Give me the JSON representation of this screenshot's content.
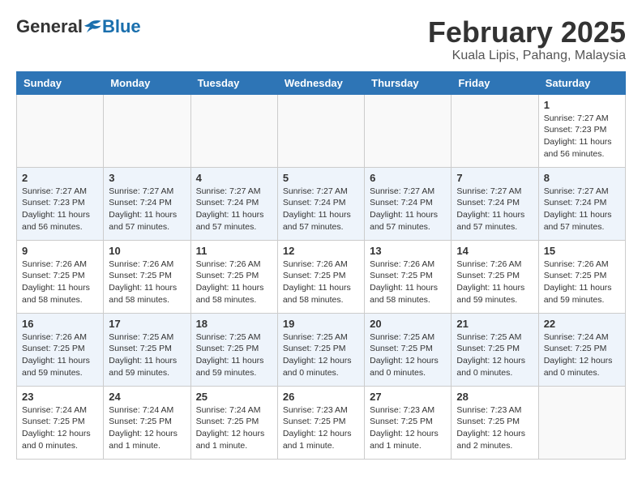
{
  "header": {
    "logo_general": "General",
    "logo_blue": "Blue",
    "title": "February 2025",
    "subtitle": "Kuala Lipis, Pahang, Malaysia"
  },
  "weekdays": [
    "Sunday",
    "Monday",
    "Tuesday",
    "Wednesday",
    "Thursday",
    "Friday",
    "Saturday"
  ],
  "weeks": [
    [
      {
        "day": "",
        "info": ""
      },
      {
        "day": "",
        "info": ""
      },
      {
        "day": "",
        "info": ""
      },
      {
        "day": "",
        "info": ""
      },
      {
        "day": "",
        "info": ""
      },
      {
        "day": "",
        "info": ""
      },
      {
        "day": "1",
        "info": "Sunrise: 7:27 AM\nSunset: 7:23 PM\nDaylight: 11 hours\nand 56 minutes."
      }
    ],
    [
      {
        "day": "2",
        "info": "Sunrise: 7:27 AM\nSunset: 7:23 PM\nDaylight: 11 hours\nand 56 minutes."
      },
      {
        "day": "3",
        "info": "Sunrise: 7:27 AM\nSunset: 7:24 PM\nDaylight: 11 hours\nand 57 minutes."
      },
      {
        "day": "4",
        "info": "Sunrise: 7:27 AM\nSunset: 7:24 PM\nDaylight: 11 hours\nand 57 minutes."
      },
      {
        "day": "5",
        "info": "Sunrise: 7:27 AM\nSunset: 7:24 PM\nDaylight: 11 hours\nand 57 minutes."
      },
      {
        "day": "6",
        "info": "Sunrise: 7:27 AM\nSunset: 7:24 PM\nDaylight: 11 hours\nand 57 minutes."
      },
      {
        "day": "7",
        "info": "Sunrise: 7:27 AM\nSunset: 7:24 PM\nDaylight: 11 hours\nand 57 minutes."
      },
      {
        "day": "8",
        "info": "Sunrise: 7:27 AM\nSunset: 7:24 PM\nDaylight: 11 hours\nand 57 minutes."
      }
    ],
    [
      {
        "day": "9",
        "info": "Sunrise: 7:26 AM\nSunset: 7:25 PM\nDaylight: 11 hours\nand 58 minutes."
      },
      {
        "day": "10",
        "info": "Sunrise: 7:26 AM\nSunset: 7:25 PM\nDaylight: 11 hours\nand 58 minutes."
      },
      {
        "day": "11",
        "info": "Sunrise: 7:26 AM\nSunset: 7:25 PM\nDaylight: 11 hours\nand 58 minutes."
      },
      {
        "day": "12",
        "info": "Sunrise: 7:26 AM\nSunset: 7:25 PM\nDaylight: 11 hours\nand 58 minutes."
      },
      {
        "day": "13",
        "info": "Sunrise: 7:26 AM\nSunset: 7:25 PM\nDaylight: 11 hours\nand 58 minutes."
      },
      {
        "day": "14",
        "info": "Sunrise: 7:26 AM\nSunset: 7:25 PM\nDaylight: 11 hours\nand 59 minutes."
      },
      {
        "day": "15",
        "info": "Sunrise: 7:26 AM\nSunset: 7:25 PM\nDaylight: 11 hours\nand 59 minutes."
      }
    ],
    [
      {
        "day": "16",
        "info": "Sunrise: 7:26 AM\nSunset: 7:25 PM\nDaylight: 11 hours\nand 59 minutes."
      },
      {
        "day": "17",
        "info": "Sunrise: 7:25 AM\nSunset: 7:25 PM\nDaylight: 11 hours\nand 59 minutes."
      },
      {
        "day": "18",
        "info": "Sunrise: 7:25 AM\nSunset: 7:25 PM\nDaylight: 11 hours\nand 59 minutes."
      },
      {
        "day": "19",
        "info": "Sunrise: 7:25 AM\nSunset: 7:25 PM\nDaylight: 12 hours\nand 0 minutes."
      },
      {
        "day": "20",
        "info": "Sunrise: 7:25 AM\nSunset: 7:25 PM\nDaylight: 12 hours\nand 0 minutes."
      },
      {
        "day": "21",
        "info": "Sunrise: 7:25 AM\nSunset: 7:25 PM\nDaylight: 12 hours\nand 0 minutes."
      },
      {
        "day": "22",
        "info": "Sunrise: 7:24 AM\nSunset: 7:25 PM\nDaylight: 12 hours\nand 0 minutes."
      }
    ],
    [
      {
        "day": "23",
        "info": "Sunrise: 7:24 AM\nSunset: 7:25 PM\nDaylight: 12 hours\nand 0 minutes."
      },
      {
        "day": "24",
        "info": "Sunrise: 7:24 AM\nSunset: 7:25 PM\nDaylight: 12 hours\nand 1 minute."
      },
      {
        "day": "25",
        "info": "Sunrise: 7:24 AM\nSunset: 7:25 PM\nDaylight: 12 hours\nand 1 minute."
      },
      {
        "day": "26",
        "info": "Sunrise: 7:23 AM\nSunset: 7:25 PM\nDaylight: 12 hours\nand 1 minute."
      },
      {
        "day": "27",
        "info": "Sunrise: 7:23 AM\nSunset: 7:25 PM\nDaylight: 12 hours\nand 1 minute."
      },
      {
        "day": "28",
        "info": "Sunrise: 7:23 AM\nSunset: 7:25 PM\nDaylight: 12 hours\nand 2 minutes."
      },
      {
        "day": "",
        "info": ""
      }
    ]
  ]
}
